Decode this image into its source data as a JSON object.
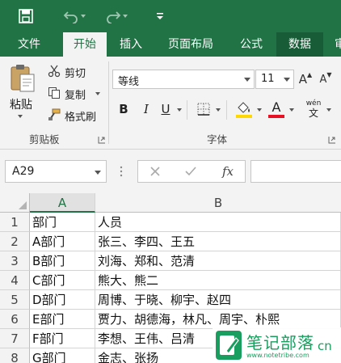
{
  "app": {
    "colors": {
      "brand": "#217346",
      "ribbon_bg": "#f3f3f3",
      "watermark": "#1a9e5f",
      "font_color_bar": "#e81123"
    }
  },
  "quick_access": {
    "icons": [
      "save-icon",
      "undo-icon",
      "redo-icon",
      "customize-icon"
    ]
  },
  "tabs": [
    {
      "label": "文件"
    },
    {
      "label": "开始"
    },
    {
      "label": "插入"
    },
    {
      "label": "页面布局"
    },
    {
      "label": "公式"
    },
    {
      "label": "数据"
    },
    {
      "label": "审"
    }
  ],
  "ribbon": {
    "clipboard": {
      "paste_label": "粘贴",
      "cut_label": "剪切",
      "copy_label": "复制",
      "format_painter_label": "格式刷",
      "group_label": "剪贴板"
    },
    "font": {
      "font_name": "等线",
      "font_size": "11",
      "bold": "B",
      "italic": "I",
      "underline": "U",
      "font_color_glyph": "A",
      "phonetic_glyph": "wén",
      "phonetic_sub": "文",
      "grow_glyph": "A",
      "shrink_glyph": "A",
      "group_label": "字体"
    }
  },
  "formula_bar": {
    "name_box": "A29",
    "fx_label": "fx",
    "value": ""
  },
  "sheet": {
    "columns": [
      "A",
      "B"
    ],
    "rows": [
      {
        "num": "1",
        "a": "部门",
        "b": "人员"
      },
      {
        "num": "2",
        "a": "A部门",
        "b": "张三、李四、王五"
      },
      {
        "num": "3",
        "a": "B部门",
        "b": "刘海、郑和、范清"
      },
      {
        "num": "4",
        "a": "C部门",
        "b": "熊大、熊二"
      },
      {
        "num": "5",
        "a": "D部门",
        "b": "周博、于晓、柳宇、赵四"
      },
      {
        "num": "6",
        "a": "E部门",
        "b": "贾力、胡德海，林凡、周宇、朴熙"
      },
      {
        "num": "7",
        "a": "F部门",
        "b": "李想、王伟、吕清"
      },
      {
        "num": "8",
        "a": "G部门",
        "b": "金志、张扬"
      }
    ]
  },
  "watermark": {
    "title": "笔记部落",
    "cn": "cn",
    "url": "www.notetribe.com"
  }
}
